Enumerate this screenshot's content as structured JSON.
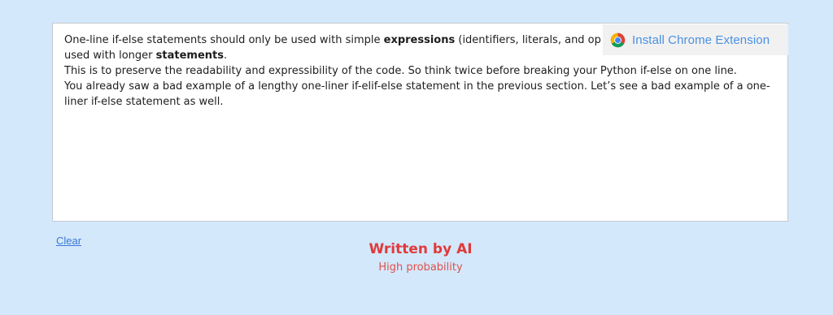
{
  "editor": {
    "line1_pre": "One-line if-else statements should only be used with simple ",
    "line1_bold": "expressions",
    "line1_post": " (identifiers, literals, and op",
    "line2_pre": "used with longer ",
    "line2_bold": "statements",
    "line2_post": ".",
    "line3": "This is to preserve the readability and expressibility of the code. So think twice before breaking your Python if-else on one line.",
    "line4": "You already saw a bad example of a lengthy one-liner if-elif-else statement in the previous section. Let’s see a bad example of a one-liner if-else statement as well."
  },
  "extension_banner": {
    "label": "Install Chrome Extension",
    "icon": "chrome-icon"
  },
  "clear_label": "Clear",
  "result": {
    "title": "Written by AI",
    "subtitle": "High probability"
  },
  "colors": {
    "background": "#d3e8fb",
    "link": "#4a90e2",
    "result": "#e03a3a"
  }
}
